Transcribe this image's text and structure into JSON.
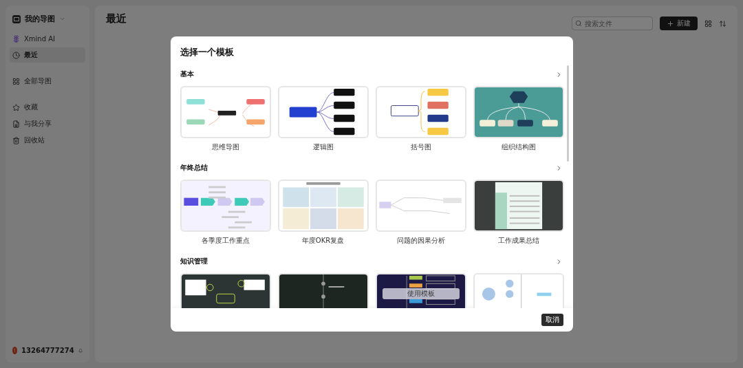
{
  "sidebar": {
    "workspace": "我的导图",
    "groups": [
      {
        "items": [
          {
            "label": "Xmind AI",
            "kind": "ai",
            "selected": false
          },
          {
            "label": "最近",
            "kind": "recent",
            "selected": true
          }
        ]
      },
      {
        "items": [
          {
            "label": "全部导图",
            "kind": "all",
            "selected": false
          }
        ]
      },
      {
        "items": [
          {
            "label": "收藏",
            "kind": "favorite",
            "selected": false
          },
          {
            "label": "与我分享",
            "kind": "shared",
            "selected": false
          },
          {
            "label": "回收站",
            "kind": "trash",
            "selected": false
          }
        ]
      }
    ],
    "user": {
      "badge": "!",
      "name": "13264777274"
    }
  },
  "main": {
    "title": "最近",
    "search": {
      "placeholder": "搜索文件"
    },
    "new_button": "新建"
  },
  "dialog": {
    "title": "选择一个模板",
    "sections": [
      {
        "heading": "基本",
        "cards": [
          {
            "caption": "思维导图",
            "kind": "mindmap"
          },
          {
            "caption": "逻辑图",
            "kind": "logic"
          },
          {
            "caption": "括号图",
            "kind": "brace"
          },
          {
            "caption": "组织结构图",
            "kind": "org"
          }
        ]
      },
      {
        "heading": "年终总结",
        "cards": [
          {
            "caption": "各季度工作重点",
            "kind": "timeline"
          },
          {
            "caption": "年度OKR复盘",
            "kind": "grid"
          },
          {
            "caption": "问题的因果分析",
            "kind": "flow"
          },
          {
            "caption": "工作成果总结",
            "kind": "table"
          }
        ]
      },
      {
        "heading": "知识管理",
        "cards": [
          {
            "kind": "darkmap"
          },
          {
            "kind": "darkline"
          },
          {
            "kind": "list",
            "hover_label": "使用模板"
          },
          {
            "kind": "cloud"
          }
        ]
      }
    ],
    "cancel_button": "取消"
  }
}
